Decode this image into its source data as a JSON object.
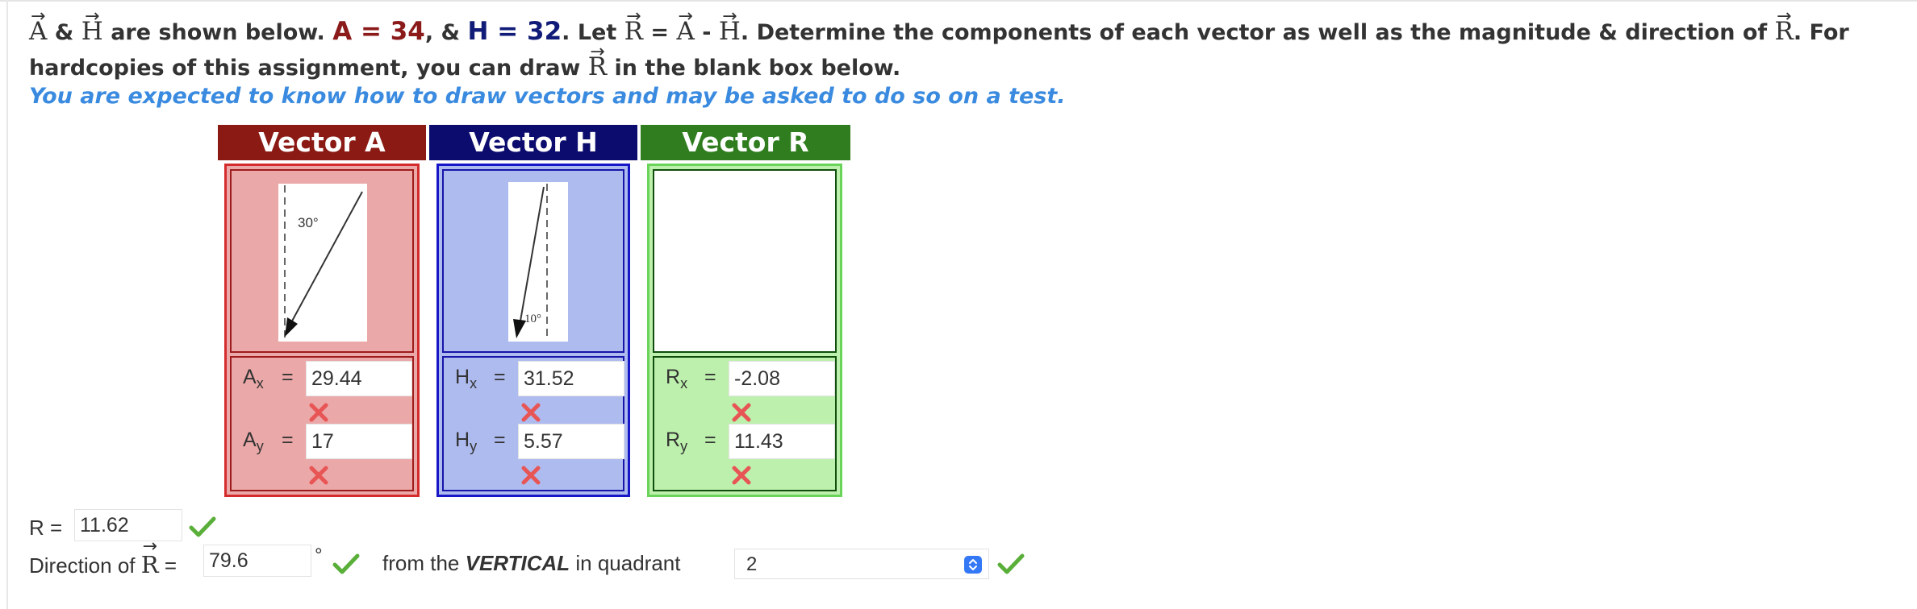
{
  "prompt": {
    "vec_a": "A",
    "vec_h": "H",
    "vec_r": "R",
    "amp": "&",
    "are_shown": "are shown below.",
    "a_label": "A = 34",
    "comma_amp": ", &",
    "h_label": "H = 32",
    "let": ". Let",
    "equals": "=",
    "minus": "-",
    "determine": ". Determine the components of each vector as well as the magnitude & direction of",
    "for_hardcopies": ". For hardcopies of this assignment, you can draw",
    "blank_box": "in the blank box below."
  },
  "note": "You are expected to know how to draw vectors and may be asked to do so on a test.",
  "columns": {
    "a": {
      "header": "Vector A",
      "angle_label": "30°",
      "x_label": "A",
      "x_sub": "x",
      "x_value": "29.44",
      "y_label": "A",
      "y_sub": "y",
      "y_value": "17"
    },
    "h": {
      "header": "Vector H",
      "angle_label": "10°",
      "x_label": "H",
      "x_sub": "x",
      "x_value": "31.52",
      "y_label": "H",
      "y_sub": "y",
      "y_value": "5.57"
    },
    "r": {
      "header": "Vector R",
      "x_label": "R",
      "x_sub": "x",
      "x_value": "-2.08",
      "y_label": "R",
      "y_sub": "y",
      "y_value": "11.43"
    }
  },
  "equals_sign": "=",
  "magnitude": {
    "label": "R =",
    "value": "11.62"
  },
  "direction": {
    "label": "Direction of",
    "vec": "R",
    "equals": "=",
    "value": "79.6",
    "degree": "°",
    "from_text": "from the",
    "vertical": "VERTICAL",
    "in_quadrant": "in quadrant",
    "quadrant_selected": "2"
  },
  "colors": {
    "vector_a": "#8b1a14",
    "vector_h": "#0c0c6e",
    "vector_r": "#2f7d1f",
    "note_blue": "#3a8be0",
    "wrong_red": "#e85555",
    "correct_green": "#5aaf3a"
  },
  "icons": {
    "wrong": "x-mark-icon",
    "correct": "check-mark-icon",
    "select": "chevron-updown-icon"
  }
}
